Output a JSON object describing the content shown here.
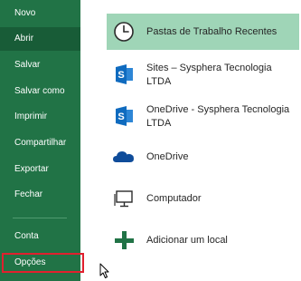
{
  "nav": {
    "items": [
      {
        "label": "Novo"
      },
      {
        "label": "Abrir"
      },
      {
        "label": "Salvar"
      },
      {
        "label": "Salvar como"
      },
      {
        "label": "Imprimir"
      },
      {
        "label": "Compartilhar"
      },
      {
        "label": "Exportar"
      },
      {
        "label": "Fechar"
      },
      {
        "label": "Conta"
      },
      {
        "label": "Opções"
      }
    ],
    "active": "Abrir",
    "highlighted": "Opções"
  },
  "locations": {
    "items": [
      {
        "label": "Pastas de Trabalho Recentes",
        "icon": "clock-icon"
      },
      {
        "label": "Sites – Sysphera Tecnologia LTDA",
        "icon": "sharepoint-icon"
      },
      {
        "label": "OneDrive - Sysphera Tecnologia LTDA",
        "icon": "sharepoint-icon"
      },
      {
        "label": "OneDrive",
        "icon": "cloud-icon"
      },
      {
        "label": "Computador",
        "icon": "computer-icon"
      },
      {
        "label": "Adicionar um local",
        "icon": "plus-icon"
      }
    ],
    "selected": "Pastas de Trabalho Recentes"
  },
  "colors": {
    "sidebar_bg": "#217346",
    "sidebar_active": "#185c37",
    "selection_bg": "#9fd5b7",
    "highlight_border": "#e0202e",
    "sharepoint_blue": "#0f6bbf",
    "onedrive_blue": "#0f4c9a",
    "add_green": "#217346"
  }
}
